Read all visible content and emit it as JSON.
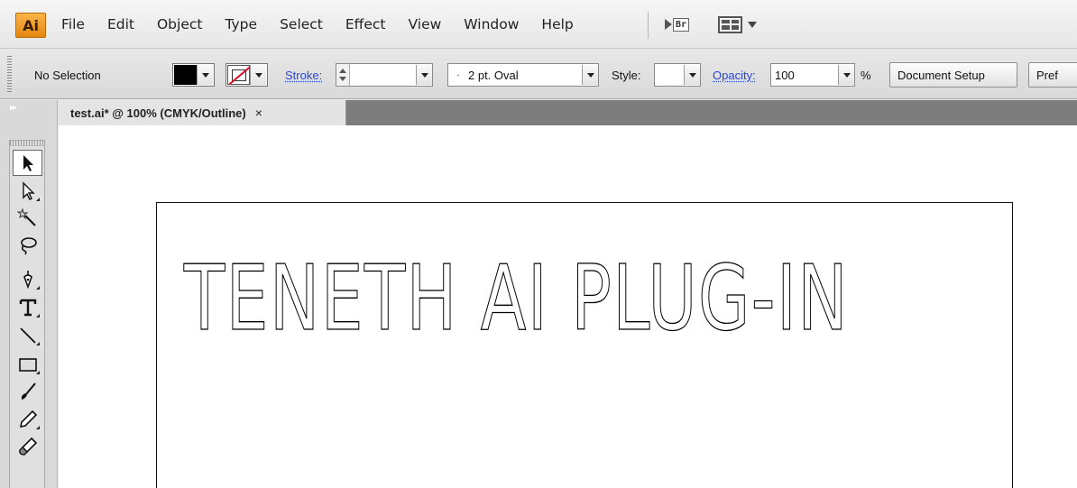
{
  "app": {
    "logo_text": "Ai"
  },
  "menu": [
    "File",
    "Edit",
    "Object",
    "Type",
    "Select",
    "Effect",
    "View",
    "Window",
    "Help"
  ],
  "menubar_icons": {
    "bridge_label": "Br"
  },
  "control_bar": {
    "selection_label": "No Selection",
    "fill_color": "#000000",
    "stroke_label": "Stroke:",
    "stroke_value": "",
    "brush_value": "2 pt. Oval",
    "style_label": "Style:",
    "opacity_label": "Opacity:",
    "opacity_value": "100",
    "percent_sign": "%",
    "document_setup_label": "Document Setup",
    "preferences_label": "Pref"
  },
  "document_tab": {
    "title": "test.ai* @ 100% (CMYK/Outline)",
    "close_glyph": "×"
  },
  "tools": [
    "selection-tool",
    "direct-selection-tool",
    "magic-wand-tool",
    "lasso-tool",
    "pen-tool",
    "type-tool",
    "line-segment-tool",
    "rectangle-tool",
    "paintbrush-tool",
    "pencil-tool",
    "blob-brush-tool"
  ],
  "artboard": {
    "text": "TENETH AI PLUG-IN"
  },
  "colors": {
    "accent": "#e08a1e",
    "link": "#2846d8",
    "stroke_none_slash": "#d8142a"
  }
}
